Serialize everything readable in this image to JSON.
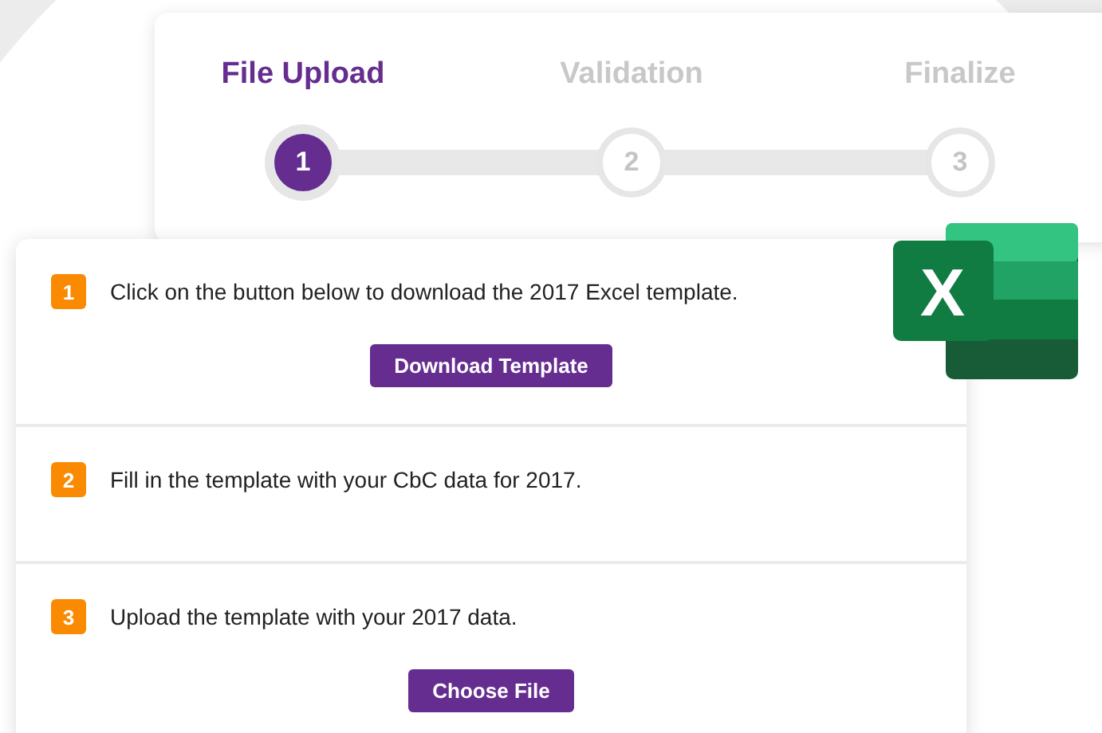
{
  "stepper": {
    "steps": [
      {
        "label": "File Upload",
        "number": "1",
        "selected": true
      },
      {
        "label": "Validation",
        "number": "2",
        "selected": false
      },
      {
        "label": "Finalize",
        "number": "3",
        "selected": false
      }
    ]
  },
  "logo": {
    "letter": "X"
  },
  "instructions": [
    {
      "number": "1",
      "text": "Click on the button below to download the 2017 Excel template.",
      "button": "Download Template"
    },
    {
      "number": "2",
      "text": "Fill in the template with your CbC data for 2017."
    },
    {
      "number": "3",
      "text": "Upload the template with your 2017 data.",
      "button": "Choose File"
    }
  ]
}
